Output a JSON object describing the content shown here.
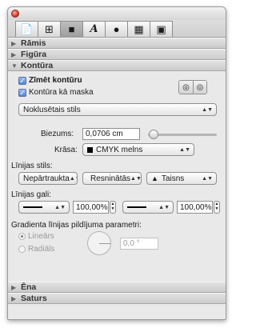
{
  "tabs": [
    {
      "icon": "document-icon"
    },
    {
      "icon": "crop-frame-icon"
    },
    {
      "icon": "square-icon"
    },
    {
      "icon": "text-a-icon"
    },
    {
      "icon": "palette-icon"
    },
    {
      "icon": "film-icon"
    },
    {
      "icon": "lock-icon"
    }
  ],
  "sections": {
    "ramis": "Rāmis",
    "figura": "Figūra",
    "kontura": "Kontūra",
    "ena": "Ēna",
    "saturs": "Saturs"
  },
  "kontura": {
    "draw_outline": "Zīmēt kontūru",
    "outline_as_mask": "Kontūra kā maska",
    "style_select": "Noklusētais stils",
    "thickness_label": "Biezums:",
    "thickness_value": "0,0706 cm",
    "thickness_slider_fraction": 0.02,
    "color_label": "Krāsa:",
    "color_value": "CMYK melns",
    "line_style_label": "Līnijas stils:",
    "line_style_1": "Nepārtraukta",
    "line_style_2": "Resninātās",
    "line_style_3": "Taisns",
    "line_ends_label": "Līnijas gali:",
    "line_end_left_pct": "100,00%",
    "line_end_right_pct": "100,00%",
    "gradient_label": "Gradienta līnijas pildījuma parametri:",
    "linear": "Lineārs",
    "radial": "Radiāls",
    "angle_value": "0,0 °"
  },
  "colors": {
    "accent": "#4d86d8",
    "panel_bg": "#e9e9e9"
  }
}
